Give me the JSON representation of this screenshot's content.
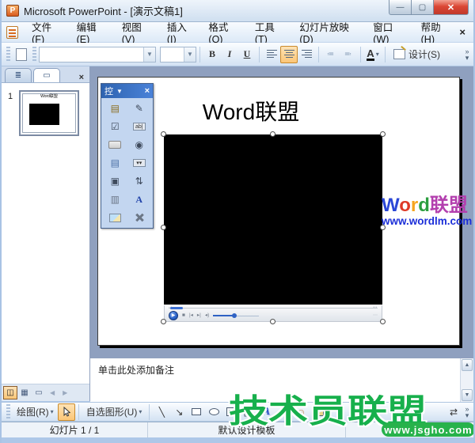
{
  "titlebar": {
    "title": "Microsoft PowerPoint - [演示文稿1]"
  },
  "menubar": {
    "items": [
      "文件(F)",
      "编辑(E)",
      "视图(V)",
      "插入(I)",
      "格式(O)",
      "工具(T)",
      "幻灯片放映(D)",
      "窗口(W)",
      "帮助(H)"
    ],
    "close_label": "×"
  },
  "format_toolbar": {
    "bold": "B",
    "italic": "I",
    "underline": "U",
    "font_color_letter": "A",
    "design_label": "设计(S)"
  },
  "slides_panel": {
    "slide_number": "1"
  },
  "control_toolbox": {
    "title": "控",
    "tools": [
      "properties",
      "view-code",
      "checkbox",
      "textbox",
      "command-button",
      "option-button",
      "list-box",
      "combo-box",
      "toggle-button",
      "spin-button",
      "scrollbar",
      "label",
      "image",
      "more-controls"
    ]
  },
  "slide": {
    "title": "Word联盟"
  },
  "slide_watermark": {
    "letters": [
      {
        "ch": "W",
        "color": "#2a46d6"
      },
      {
        "ch": "o",
        "color": "#de3a28"
      },
      {
        "ch": "r",
        "color": "#f6a41d"
      },
      {
        "ch": "d",
        "color": "#2c9e3f"
      }
    ],
    "suffix": "联盟",
    "suffix_color": "#b33fae",
    "url": "www.wordlm.com",
    "url_color": "#1b2ed8"
  },
  "notes": {
    "placeholder": "单击此处添加备注"
  },
  "drawing_toolbar": {
    "draw_label": "绘图(R)",
    "autoshapes_label": "自选图形(U)"
  },
  "statusbar": {
    "slide_indicator": "幻灯片 1 / 1",
    "template_name": "默认设计模板"
  },
  "site_watermark": {
    "brand": "技术员联盟",
    "url": "www.jsgho.com",
    "color": "#17b04c"
  }
}
